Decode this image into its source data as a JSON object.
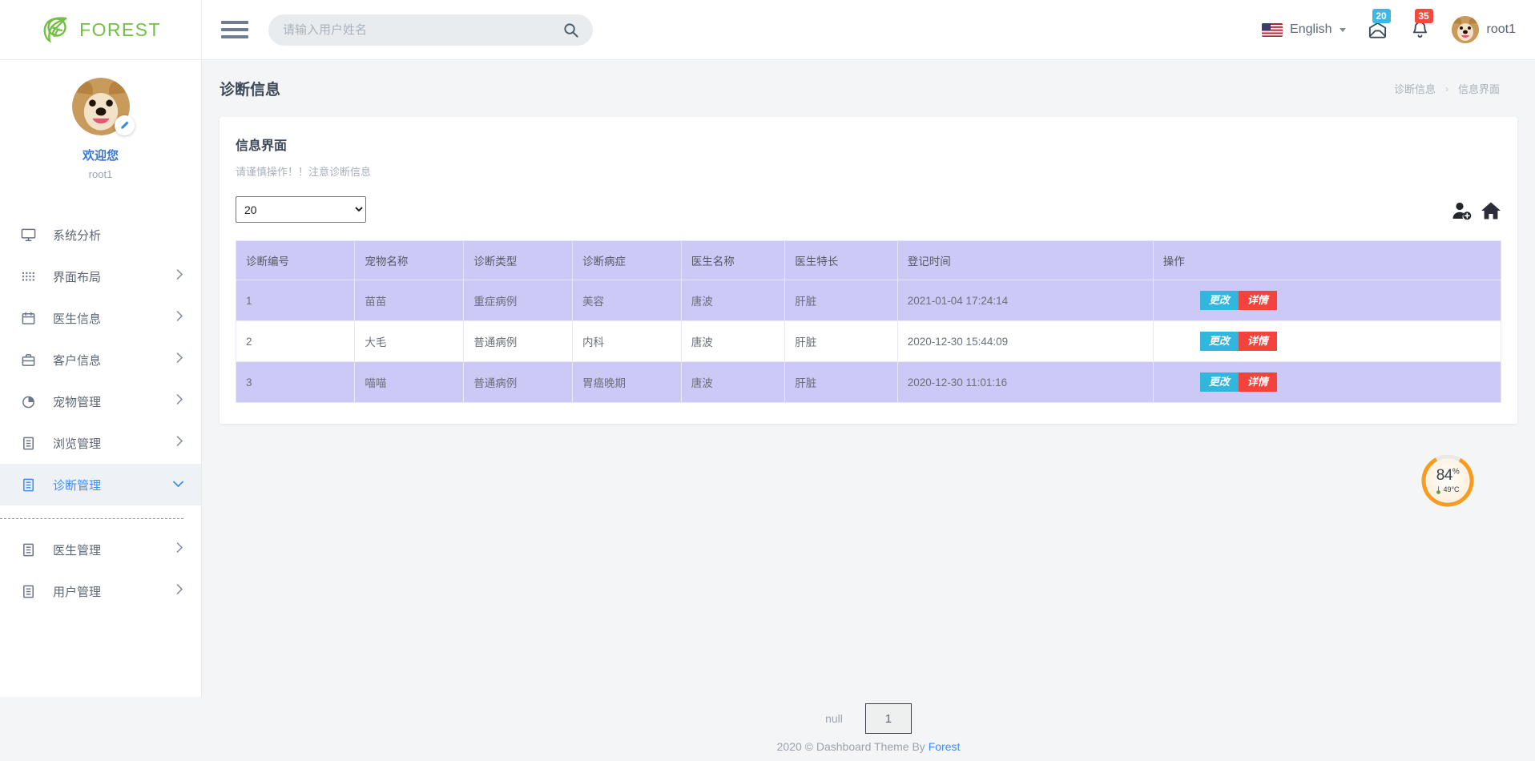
{
  "brand": {
    "name": "FOREST",
    "logo_icon": "leaf-plane-icon"
  },
  "search": {
    "placeholder": "请输入用户姓名",
    "value": "",
    "icon": "search-icon"
  },
  "topbar": {
    "menu_toggle_icon": "hamburger-icon",
    "language": {
      "label": "English",
      "flag": "us-flag-icon",
      "caret_icon": "chevron-down-icon"
    },
    "messages": {
      "icon": "envelope-icon",
      "count": "20"
    },
    "notifications": {
      "icon": "bell-icon",
      "count": "35"
    },
    "user": {
      "name": "root1",
      "avatar_icon": "dog-avatar"
    }
  },
  "sidebar": {
    "profile": {
      "welcome": "欢迎您",
      "username": "root1",
      "avatar_icon": "dog-avatar",
      "edit_icon": "pencil-icon"
    },
    "items": [
      {
        "label": "系统分析",
        "icon": "monitor-icon",
        "arrow": "",
        "active": false
      },
      {
        "label": "界面布局",
        "icon": "grid-dots-icon",
        "arrow": "›",
        "active": false
      },
      {
        "label": "医生信息",
        "icon": "calendar-icon",
        "arrow": "›",
        "active": false
      },
      {
        "label": "客户信息",
        "icon": "briefcase-icon",
        "arrow": "›",
        "active": false
      },
      {
        "label": "宠物管理",
        "icon": "pie-chart-icon",
        "arrow": "›",
        "active": false
      },
      {
        "label": "浏览管理",
        "icon": "document-icon",
        "arrow": "›",
        "active": false
      },
      {
        "label": "诊断管理",
        "icon": "document-icon",
        "arrow": "⌄",
        "active": true
      }
    ],
    "items_after_divider": [
      {
        "label": "医生管理",
        "icon": "document-icon",
        "arrow": "›",
        "active": false
      },
      {
        "label": "用户管理",
        "icon": "document-icon",
        "arrow": "›",
        "active": false
      }
    ]
  },
  "page": {
    "title": "诊断信息",
    "breadcrumb": [
      "诊断信息",
      "信息界面"
    ],
    "breadcrumb_separator": "›"
  },
  "card": {
    "title": "信息界面",
    "subtitle": "请谨慎操作！！注意诊断信息",
    "page_length": {
      "value": "20",
      "options": [
        "20"
      ]
    },
    "tools": [
      {
        "name": "add-user-icon"
      },
      {
        "name": "home-icon"
      }
    ]
  },
  "table": {
    "columns": [
      "诊断编号",
      "宠物名称",
      "诊断类型",
      "诊断病症",
      "医生名称",
      "医生特长",
      "登记时间",
      "操作"
    ],
    "rows": [
      {
        "id": "1",
        "pet": "苗苗",
        "type": "重症病例",
        "symptom": "美容",
        "doctor": "唐波",
        "specialty": "肝脏",
        "time": "2021-01-04 17:24:14"
      },
      {
        "id": "2",
        "pet": "大毛",
        "type": "普通病例",
        "symptom": "内科",
        "doctor": "唐波",
        "specialty": "肝脏",
        "time": "2020-12-30 15:44:09"
      },
      {
        "id": "3",
        "pet": "喵喵",
        "type": "普通病例",
        "symptom": "胃癌晚期",
        "doctor": "唐波",
        "specialty": "肝脏",
        "time": "2020-12-30 11:01:16"
      }
    ],
    "actions": {
      "edit": "更改",
      "detail": "详情"
    }
  },
  "gauge": {
    "percent": "84",
    "percent_unit": "%",
    "temperature": "49°C",
    "temp_icon": "thermometer-icon",
    "color": "#f79c1e"
  },
  "footer": {
    "pagination_info": "null",
    "current_page": "1",
    "copyright_prefix": "2020 © Dashboard Theme By ",
    "copyright_link": "Forest"
  },
  "colors": {
    "brand_green": "#73bf45",
    "accent_blue": "#3b8ef0",
    "table_header": "#ccc9f7",
    "btn_edit": "#31b6dd",
    "btn_detail": "#f4433c",
    "badge_blue": "#3eb7e8",
    "badge_red": "#ef4b3f",
    "gauge_orange": "#f79c1e"
  }
}
